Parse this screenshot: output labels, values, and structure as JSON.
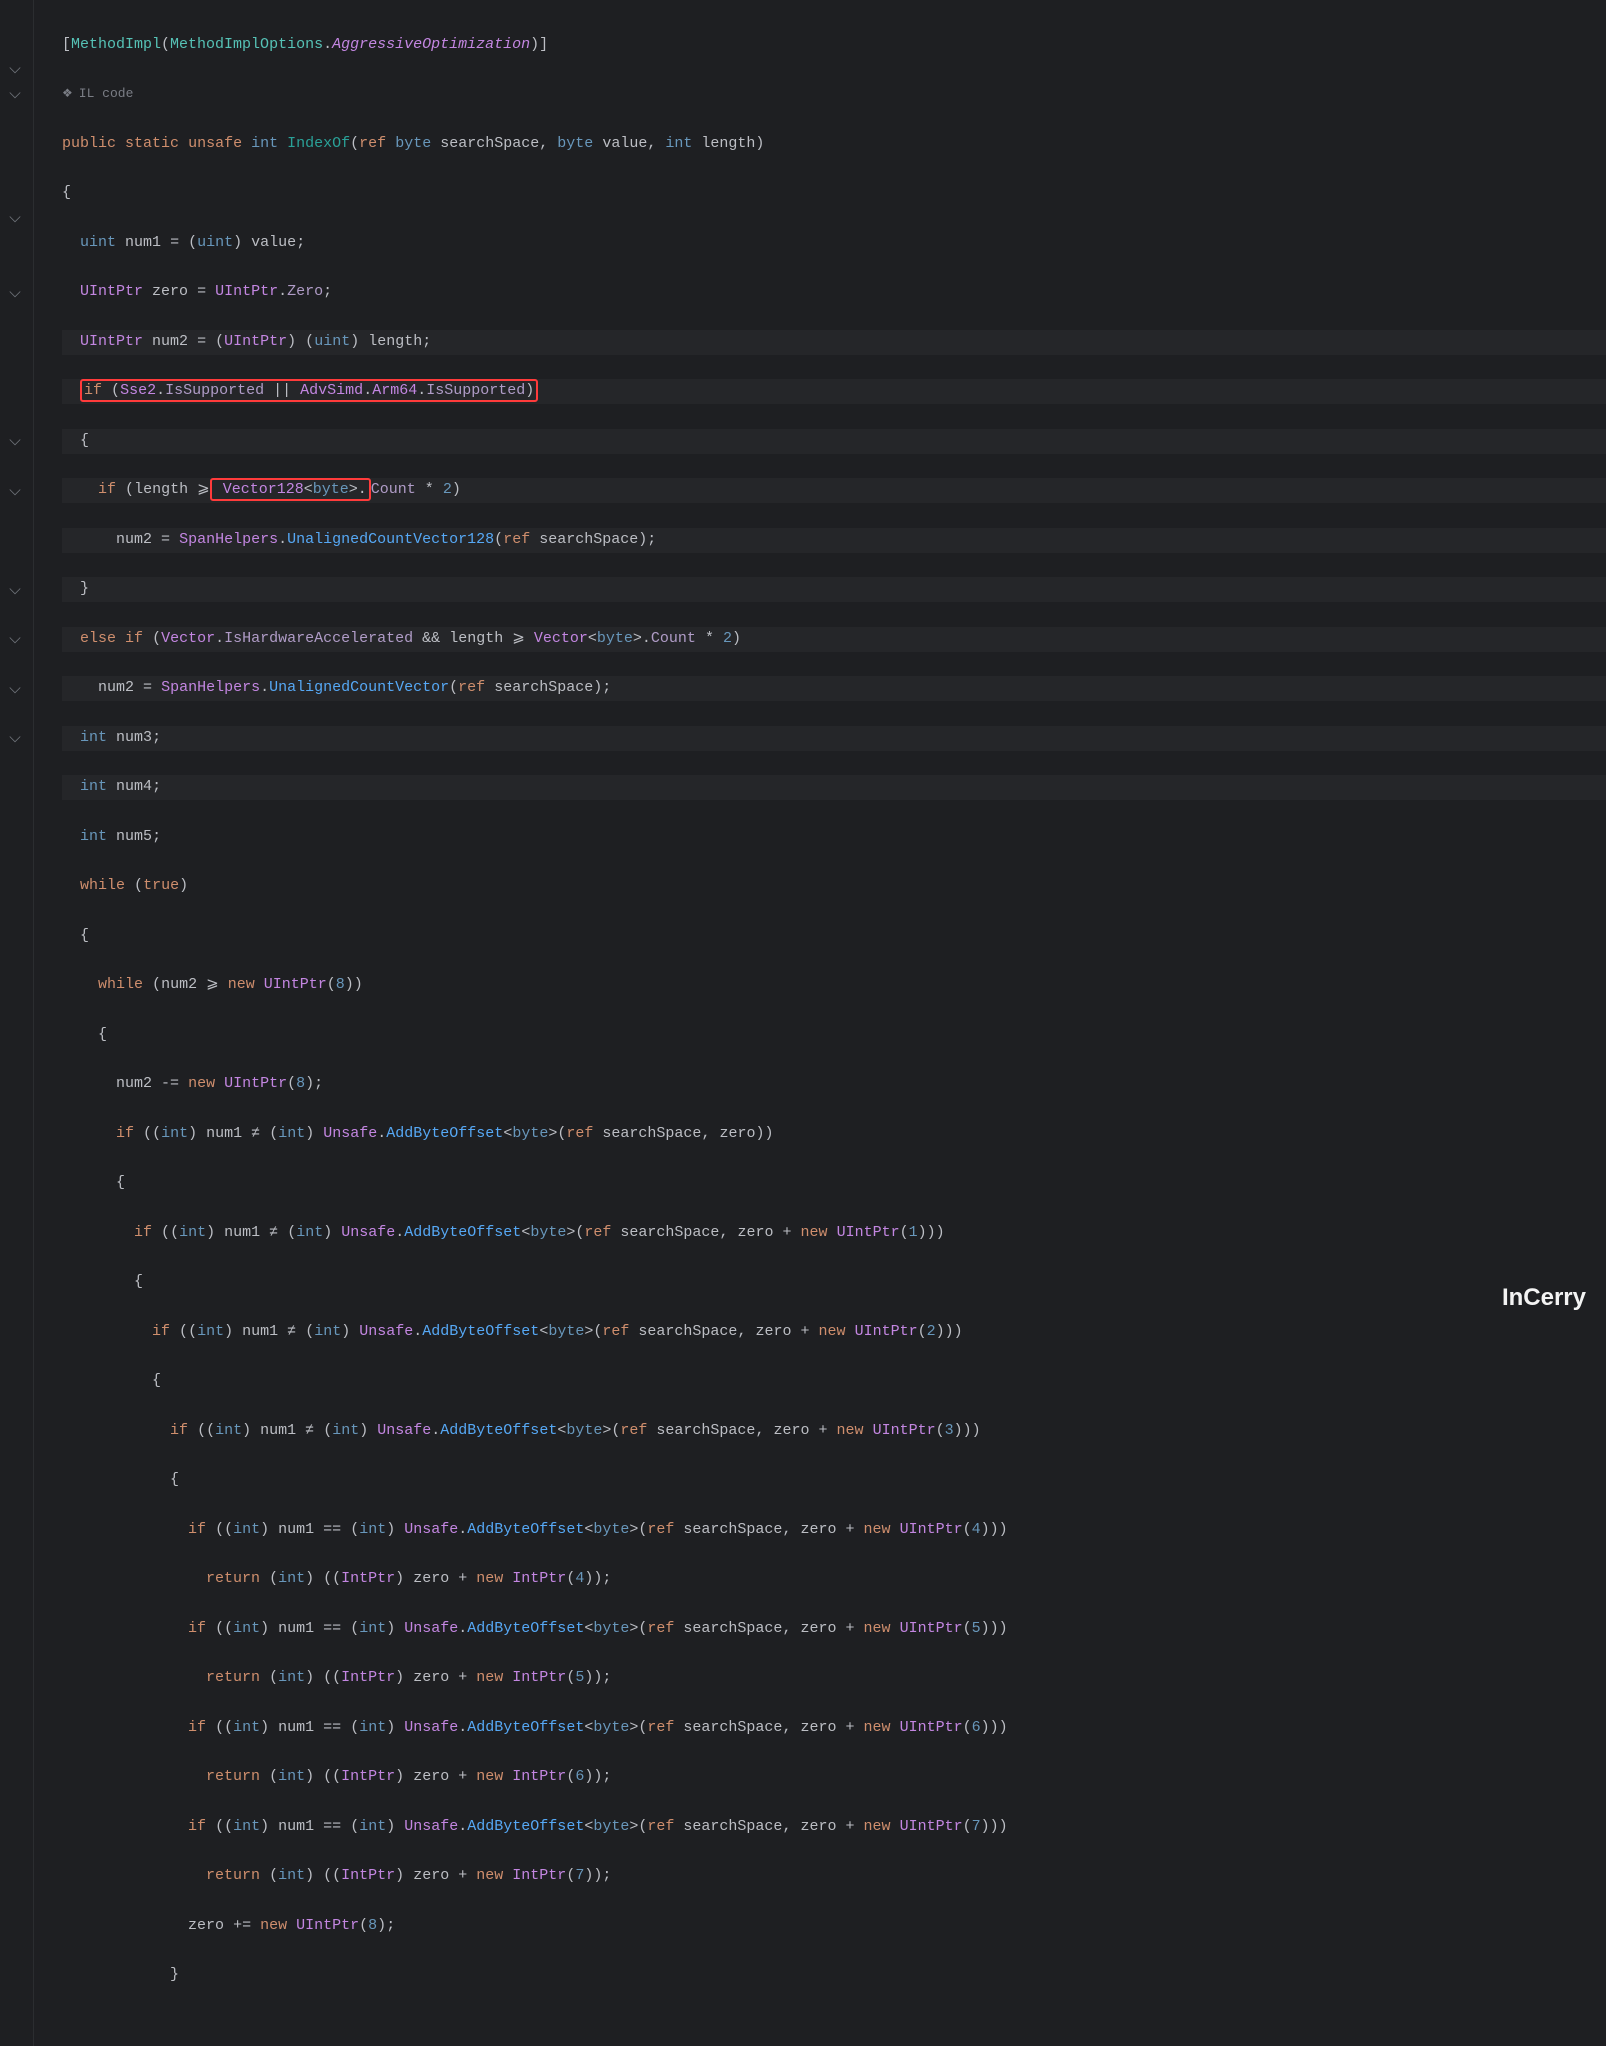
{
  "gutter": {
    "il_code_label": "IL code"
  },
  "code": {
    "attr_open": "[",
    "attr_name": "MethodImpl",
    "attr_paren_open": "(",
    "attr_enum": "MethodImplOptions",
    "attr_val": "AggressiveOptimization",
    "attr_paren_close": ")",
    "attr_close": "]",
    "sig_public": "public",
    "sig_static": "static",
    "sig_unsafe": "unsafe",
    "sig_ret": "int",
    "sig_name": "IndexOf",
    "sig_ref": "ref",
    "sig_byte": "byte",
    "sig_p1": "searchSpace",
    "sig_p2type": "byte",
    "sig_p2": "value",
    "sig_p3type": "int",
    "sig_p3": "length",
    "uint_t": "uint",
    "num1": "num1",
    "value": "value",
    "uintptr": "UIntPtr",
    "zero": "zero",
    "Zero": "Zero",
    "num2": "num2",
    "length": "length",
    "if": "if",
    "sse2": "Sse2",
    "IsSupported": "IsSupported",
    "or": "||",
    "advsimd": "AdvSimd",
    "arm64": "Arm64",
    "ge": "⩾",
    "vector128": "Vector128",
    "byte_gen": "byte",
    "Count": "Count",
    "two": "2",
    "spanhelpers": "SpanHelpers",
    "unaligned128": "UnalignedCountVector128",
    "ref": "ref",
    "else": "else",
    "vector": "Vector",
    "ishw": "IsHardwareAccelerated",
    "and": "&&",
    "unalignedv": "UnalignedCountVector",
    "int_t": "int",
    "num3": "num3",
    "num4": "num4",
    "num5": "num5",
    "while": "while",
    "true": "true",
    "new": "new",
    "eight": "8",
    "minuseq": "-=",
    "cast_int": "int",
    "neq": "≠",
    "Unsafe": "Unsafe",
    "AddByteOffset": "AddByteOffset",
    "eqeq": "==",
    "return": "return",
    "IntPtr": "IntPtr",
    "pluseq": "+=",
    "one": "1",
    "three": "3",
    "four": "4",
    "five": "5",
    "six": "6",
    "seven": "7"
  },
  "watermark": "InCerry"
}
